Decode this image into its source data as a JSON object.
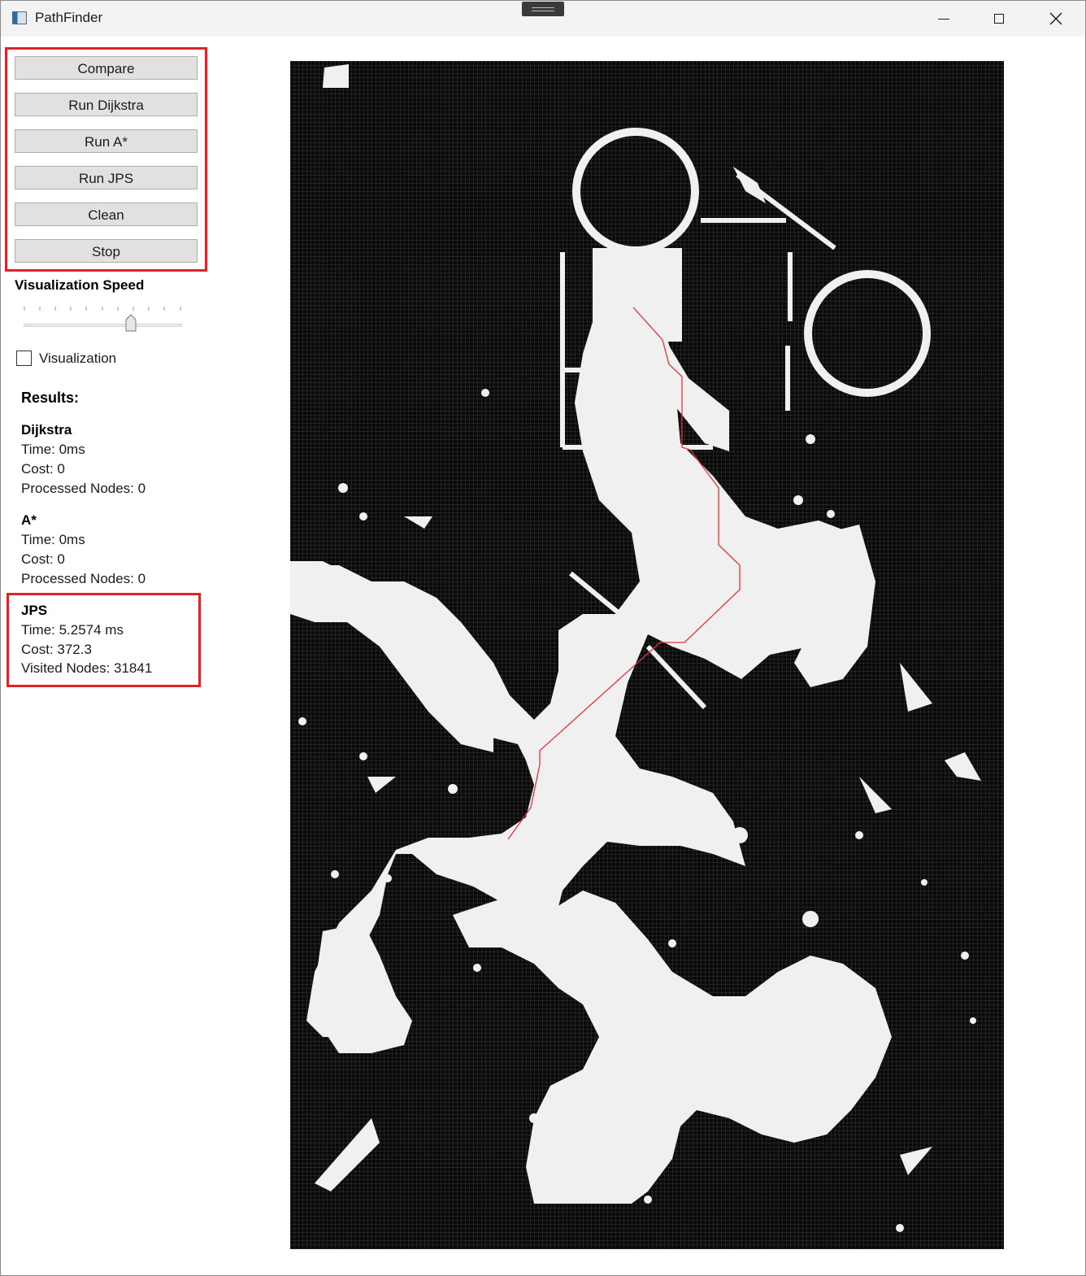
{
  "window": {
    "title": "PathFinder",
    "icon": "app-icon",
    "controls": [
      "minimize-icon",
      "maximize-icon",
      "close-icon"
    ]
  },
  "toolbar": {
    "compare_label": "Compare",
    "run_dijkstra_label": "Run Dijkstra",
    "run_astar_label": "Run A*",
    "run_jps_label": "Run JPS",
    "clean_label": "Clean",
    "stop_label": "Stop"
  },
  "speed": {
    "label": "Visualization Speed",
    "value_fraction": 0.69
  },
  "visualization": {
    "label": "Visualization",
    "checked": false
  },
  "results": {
    "title": "Results:",
    "dijkstra": {
      "name": "Dijkstra",
      "time": "Time: 0ms",
      "cost": "Cost: 0",
      "nodes": "Processed Nodes: 0"
    },
    "astar": {
      "name": "A*",
      "time": "Time: 0ms",
      "cost": "Cost: 0",
      "nodes": "Processed Nodes: 0"
    },
    "jps": {
      "name": "JPS",
      "time": "Time: 5.2574 ms",
      "cost": "Cost: 372.3",
      "nodes": "Visited Nodes: 31841"
    }
  },
  "colors": {
    "highlight_box": "#e0232b",
    "path": "#e8313a",
    "map_obstacle": "#0a0a0a",
    "map_free": "#f0f0f0"
  }
}
